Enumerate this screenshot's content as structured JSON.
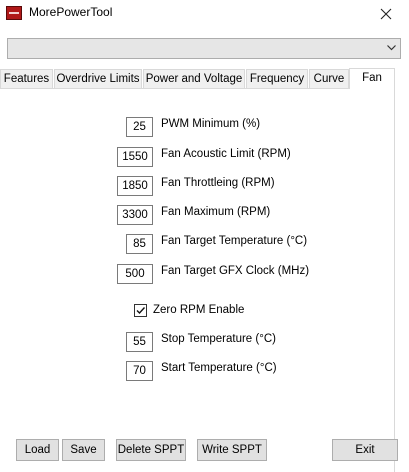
{
  "window": {
    "title": "MorePowerTool"
  },
  "profile_select": {
    "value": ""
  },
  "tabs": [
    {
      "label": "Features"
    },
    {
      "label": "Overdrive Limits"
    },
    {
      "label": "Power and Voltage"
    },
    {
      "label": "Frequency"
    },
    {
      "label": "Curve"
    },
    {
      "label": "Fan"
    }
  ],
  "active_tab": "Fan",
  "fan": {
    "pwm_minimum": {
      "value": "25",
      "label": "PWM Minimum (%)"
    },
    "acoustic_limit": {
      "value": "1550",
      "label": "Fan Acoustic Limit (RPM)"
    },
    "throttling": {
      "value": "1850",
      "label": "Fan Throttleing (RPM)"
    },
    "maximum": {
      "value": "3300",
      "label": "Fan Maximum (RPM)"
    },
    "target_temp": {
      "value": "85",
      "label": "Fan Target Temperature (°C)"
    },
    "target_gfx_clock": {
      "value": "500",
      "label": "Fan Target GFX Clock (MHz)"
    },
    "zero_rpm": {
      "checked": true,
      "label": "Zero RPM Enable"
    },
    "stop_temp": {
      "value": "55",
      "label": "Stop Temperature (°C)"
    },
    "start_temp": {
      "value": "70",
      "label": "Start Temperature (°C)"
    }
  },
  "buttons": {
    "load": "Load",
    "save": "Save",
    "delete_sppt": "Delete SPPT",
    "write_sppt": "Write SPPT",
    "exit": "Exit"
  },
  "icons": {
    "app": "app-logo-icon",
    "close": "close-icon",
    "dropdown": "chevron-down-icon",
    "check": "checkmark-icon"
  }
}
